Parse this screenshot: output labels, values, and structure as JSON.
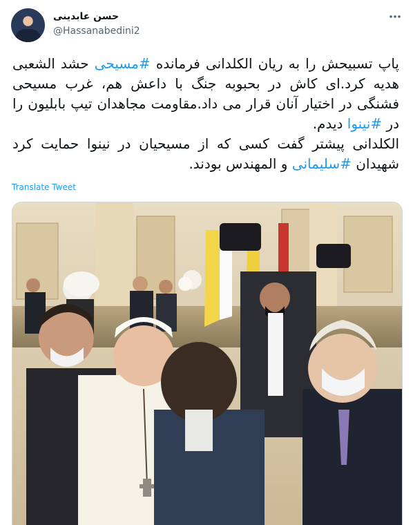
{
  "author": {
    "display_name": "حسن عابدینی",
    "handle": "@Hassanabedini2"
  },
  "tweet": {
    "lines": [
      [
        {
          "t": "پاپ تسبیحش را به ریان الکلدانی فرمانده "
        },
        {
          "t": "#مسیحی",
          "tag": true
        },
        {
          "t": " حشد الشعبی هدیه کرد.ای کاش در بحبوبه جنگ با داعش هم، غرب مسیحی فشنگی در اختیار آنان قرار می داد.مقاومت مجاهدان تیپ بابلیون را در "
        },
        {
          "t": "#نینوا",
          "tag": true
        },
        {
          "t": " دیدم."
        }
      ],
      [
        {
          "t": "الکلدانی پیشتر گفت کسی که از مسیحیان در نینوا حمایت کرد شهیدان "
        },
        {
          "t": "#سلیمانی",
          "tag": true
        },
        {
          "t": " و المهندس بودند."
        }
      ]
    ],
    "translate_label": "Translate Tweet"
  },
  "icons": {
    "more": "more-horizontal-icon"
  },
  "colors": {
    "link": "#1d9bf0",
    "text": "#0f1419",
    "secondary": "#536471"
  }
}
